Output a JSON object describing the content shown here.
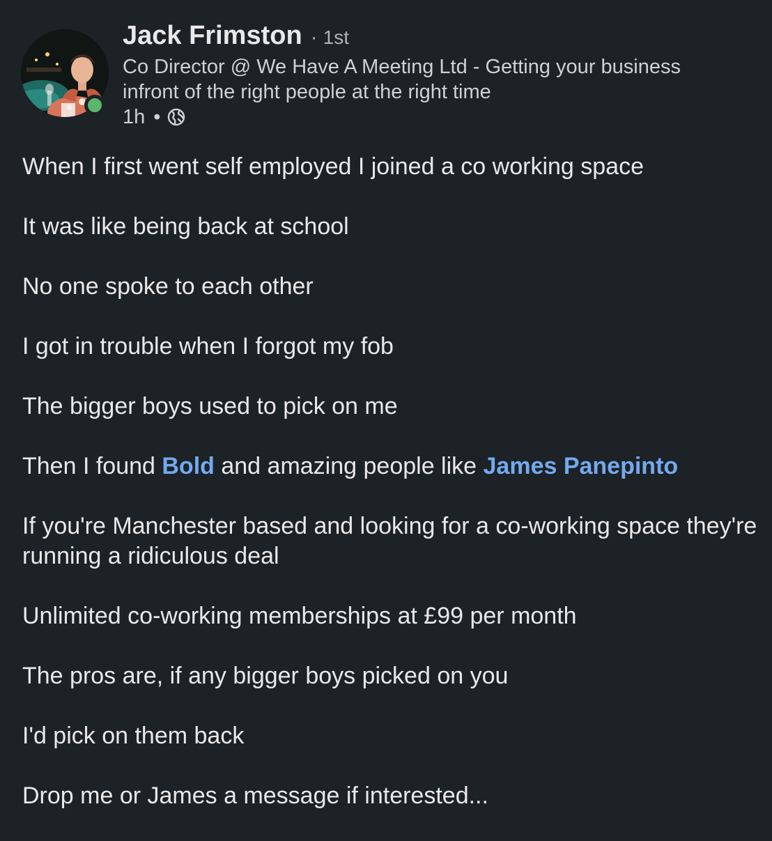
{
  "author": {
    "name": "Jack Frimston",
    "connection_separator": "·",
    "connection_degree": "1st",
    "headline": "Co Director @ We Have A Meeting Ltd - Getting your business infront of the right people at the right time",
    "time_posted": "1h",
    "meta_separator": "•",
    "visibility_icon": "globe-icon"
  },
  "post": {
    "paragraphs": [
      "When I first went self employed I joined a co working space",
      "It was like being back at school",
      "No one spoke to each other",
      "I got in trouble when I forgot my fob",
      "The bigger boys used to pick on me",
      {
        "prefix": "Then I found ",
        "mention1": "Bold",
        "middle": " and amazing people like ",
        "mention2": "James Panepinto"
      },
      "If you're Manchester based and looking for a co-working space they're running a ridiculous deal",
      "Unlimited co-working memberships at £99 per month",
      "The pros are, if any bigger boys picked on you",
      "I'd pick on them back",
      "Drop me or James a message if interested..."
    ]
  },
  "colors": {
    "background": "#1d2226",
    "text": "#e9e9ea",
    "mention": "#73a9ee",
    "presence": "#5bb66b"
  }
}
